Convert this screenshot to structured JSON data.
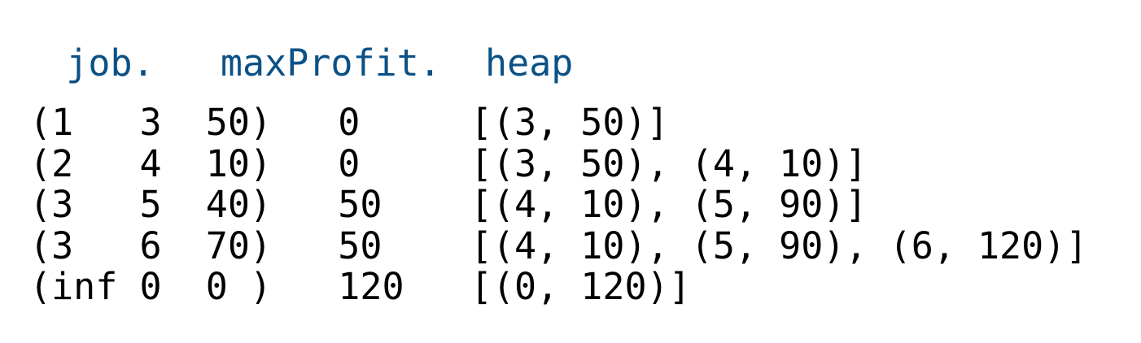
{
  "header_text": "   job.   maxProfit.  heap",
  "rows": [
    "(1   3  50)   0     [(3, 50)]",
    "(2   4  10)   0     [(3, 50), (4, 10)]",
    "(3   5  40)   50    [(4, 10), (5, 90)]",
    "(3   6  70)   50    [(4, 10), (5, 90), (6, 120)]",
    "(inf 0  0 )   120   [(0, 120)]"
  ],
  "colors": {
    "header": "#0c5186",
    "body_text": "#000000",
    "background": "#ffffff"
  }
}
